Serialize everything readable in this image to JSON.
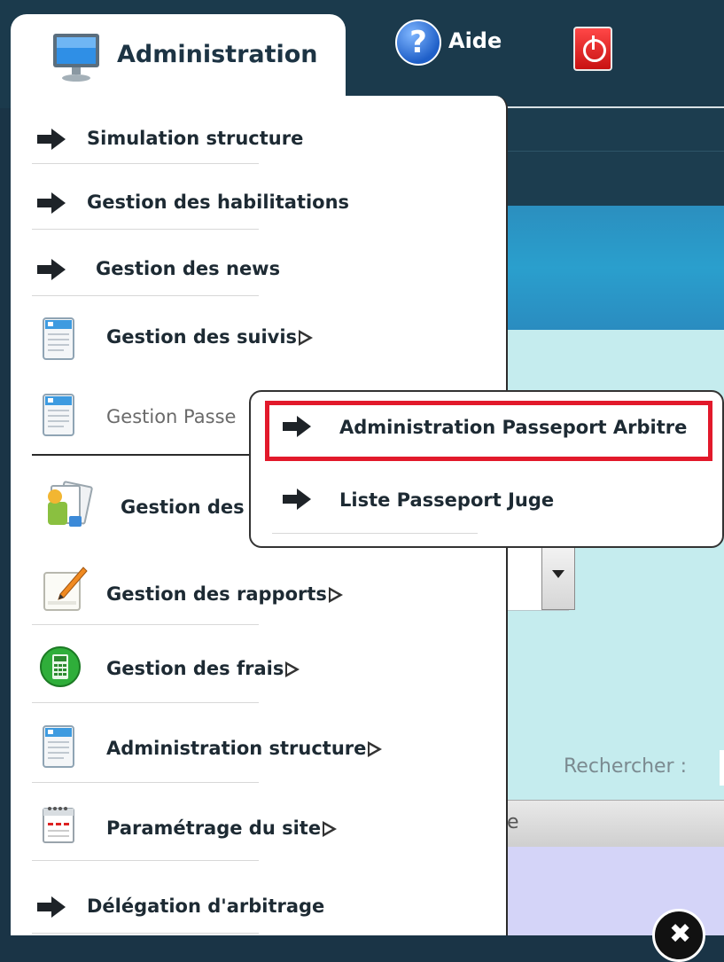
{
  "nav": {
    "admin_label": "Administration",
    "help_label": "Aide"
  },
  "menu": {
    "items": [
      {
        "label": "Simulation structure",
        "icon": "arrow-right-icon",
        "submenu": false
      },
      {
        "label": "Gestion des habilitations",
        "icon": "arrow-right-icon",
        "submenu": false
      },
      {
        "label": "Gestion des news",
        "icon": "arrow-right-icon",
        "submenu": false
      },
      {
        "label": "Gestion des suivis",
        "icon": "document-icon",
        "submenu": true
      },
      {
        "label": "Gestion Passe",
        "icon": "document-icon",
        "submenu": true,
        "active": true
      },
      {
        "label": "Gestion des",
        "icon": "files-icon",
        "submenu": true
      },
      {
        "label": "Gestion des rapports",
        "icon": "notepad-icon",
        "submenu": true
      },
      {
        "label": "Gestion des frais",
        "icon": "calculator-icon",
        "submenu": true
      },
      {
        "label": "Administration structure",
        "icon": "document-icon",
        "submenu": true
      },
      {
        "label": "Paramétrage du site",
        "icon": "calendar-icon",
        "submenu": true
      },
      {
        "label": "Délégation d'arbitrage",
        "icon": "arrow-right-icon",
        "submenu": false
      }
    ]
  },
  "submenu": {
    "items": [
      {
        "label": "Administration Passeport Arbitre",
        "highlighted": true
      },
      {
        "label": "Liste Passeport Juge",
        "highlighted": false
      }
    ]
  },
  "page": {
    "search_label": "Rechercher :",
    "table_header_fragment": "e",
    "close_glyph": "✖"
  },
  "colors": {
    "topbar": "#1b3a4c",
    "highlight_border": "#e2192b",
    "panel": "#c5ecee",
    "table_body": "#d4d4f8"
  }
}
